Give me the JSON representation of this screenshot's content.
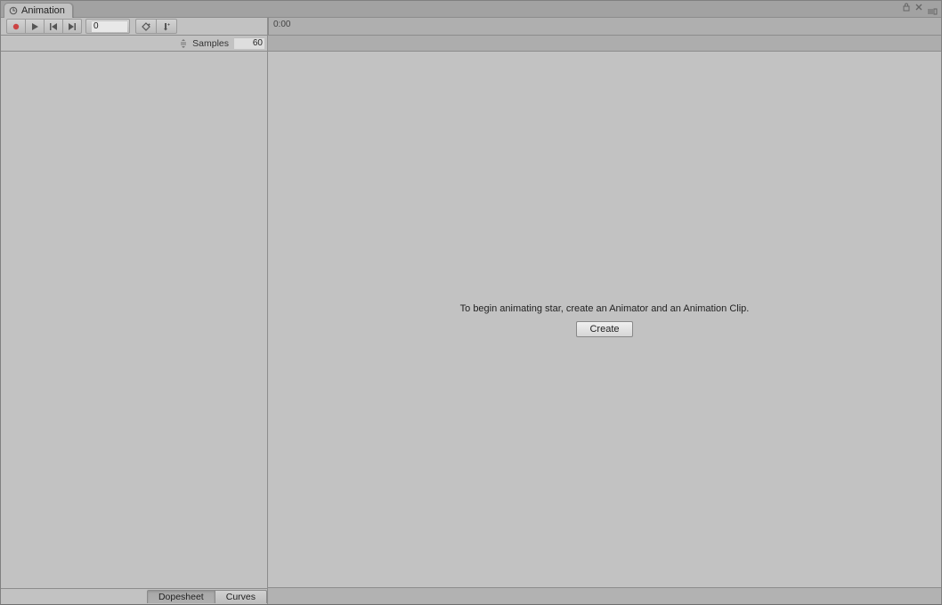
{
  "tab": {
    "title": "Animation"
  },
  "toolbar": {
    "frame_value": "0"
  },
  "timeline": {
    "time_label": "0:00"
  },
  "samples": {
    "label": "Samples",
    "value": "60"
  },
  "main": {
    "message": "To begin animating star, create an Animator and an Animation Clip.",
    "create_label": "Create"
  },
  "footer": {
    "view_dopesheet": "Dopesheet",
    "view_curves": "Curves"
  }
}
